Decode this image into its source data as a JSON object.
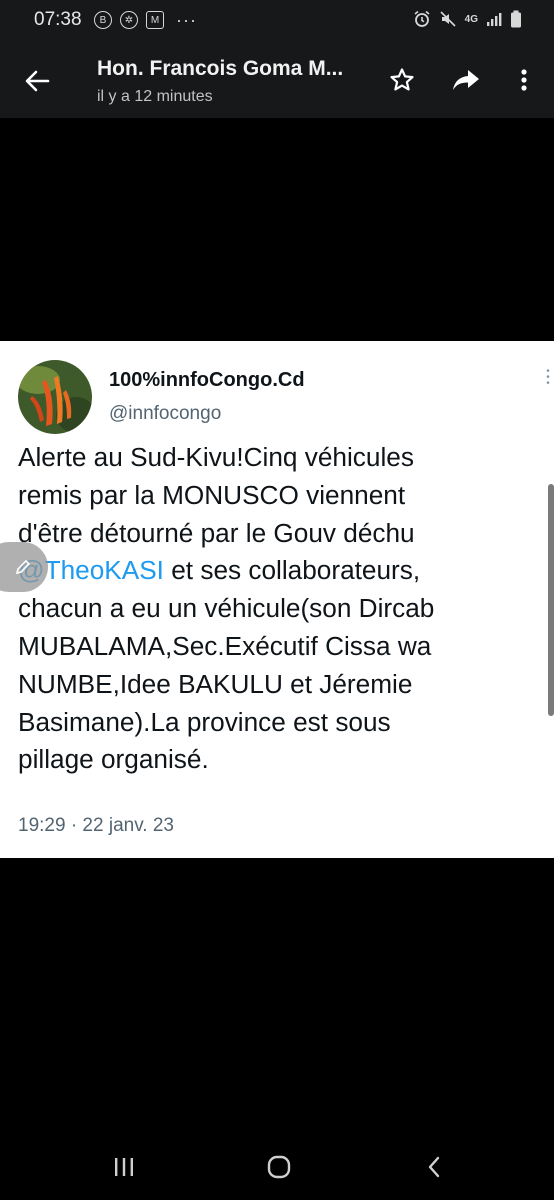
{
  "status_bar": {
    "time": "07:38",
    "left_icons": [
      "b-circle-icon",
      "pinwheel-icon",
      "m-square-icon",
      "more-dots-icon"
    ],
    "network": "4G",
    "right_icons": [
      "alarm-icon",
      "mute-icon",
      "network-4g-icon",
      "signal-icon",
      "battery-icon"
    ]
  },
  "header": {
    "title": "Hon. Francois Goma M...",
    "subtitle": "il y a 12 minutes",
    "icons": [
      "back-arrow-icon",
      "star-icon",
      "share-icon",
      "more-vert-icon"
    ]
  },
  "tweet": {
    "account_name": "100%innfoCongo.Cd",
    "handle": "@innfocongo",
    "lines": [
      "Alerte au Sud-Kivu!Cinq véhicules",
      "remis par la MONUSCO viennent",
      "d'être détourné par le Gouv déchu",
      "@TheoKASI",
      " et ses collaborateurs,",
      "chacun a eu un véhicule(son Dircab",
      "MUBALAMA,Sec.Exécutif Cissa wa",
      "NUMBE,Idee BAKULU et Jéremie",
      "Basimane).La province est sous",
      "pillage organisé."
    ],
    "timestamp": "19:29 · 22 janv. 23"
  },
  "colors": {
    "mention": "#1d9bf0",
    "header_bg": "#17181a",
    "card_bg": "#ffffff",
    "meta_gray": "#536471"
  },
  "nav": {
    "icons": [
      "recent-apps-icon",
      "home-icon",
      "back-icon"
    ]
  }
}
